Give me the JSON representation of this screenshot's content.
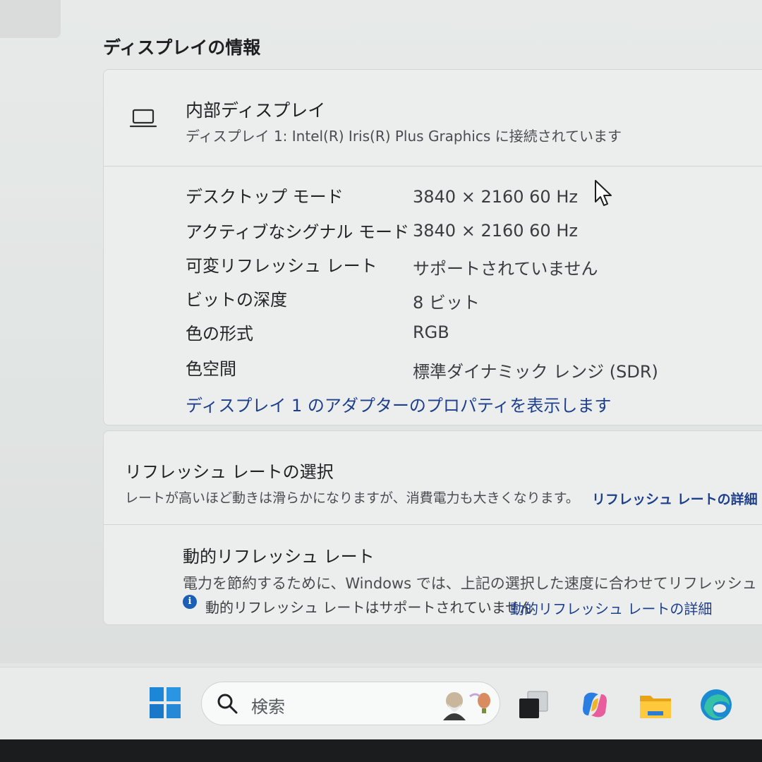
{
  "section_title": "ディスプレイの情報",
  "display": {
    "title": "内部ディスプレイ",
    "subtitle": "ディスプレイ 1: Intel(R) Iris(R) Plus Graphics に接続されています",
    "properties": [
      {
        "label": "デスクトップ モード",
        "value": "3840 × 2160 60 Hz"
      },
      {
        "label": "アクティブなシグナル モード",
        "value": "3840 × 2160 60 Hz"
      },
      {
        "label": "可変リフレッシュ レート",
        "value": "サポートされていません"
      },
      {
        "label": "ビットの深度",
        "value": "8 ビット"
      },
      {
        "label": "色の形式",
        "value": "RGB"
      },
      {
        "label": "色空間",
        "value": "標準ダイナミック レンジ (SDR)"
      }
    ],
    "adapter_link": "ディスプレイ 1 のアダプターのプロパティを表示します"
  },
  "refresh": {
    "title": "リフレッシュ レートの選択",
    "description": "レートが高いほど動きは滑らかになりますが、消費電力も大きくなります。",
    "details_link": "リフレッシュ レートの詳細",
    "dynamic": {
      "title": "動的リフレッシュ レート",
      "description": "電力を節約するために、Windows では、上記の選択した速度に合わせてリフレッシュ レート",
      "note": "動的リフレッシュ レートはサポートされていません",
      "details_link": "動的リフレッシュ レートの詳細"
    }
  },
  "taskbar": {
    "search_placeholder": "検索",
    "icons": [
      "windows-start-icon",
      "search-icon",
      "task-view-icon",
      "copilot-icon",
      "file-explorer-icon",
      "edge-icon"
    ]
  },
  "colors": {
    "link": "#1e3f8c",
    "accent": "#1a5fb4",
    "card_bg": "#eceeed"
  }
}
